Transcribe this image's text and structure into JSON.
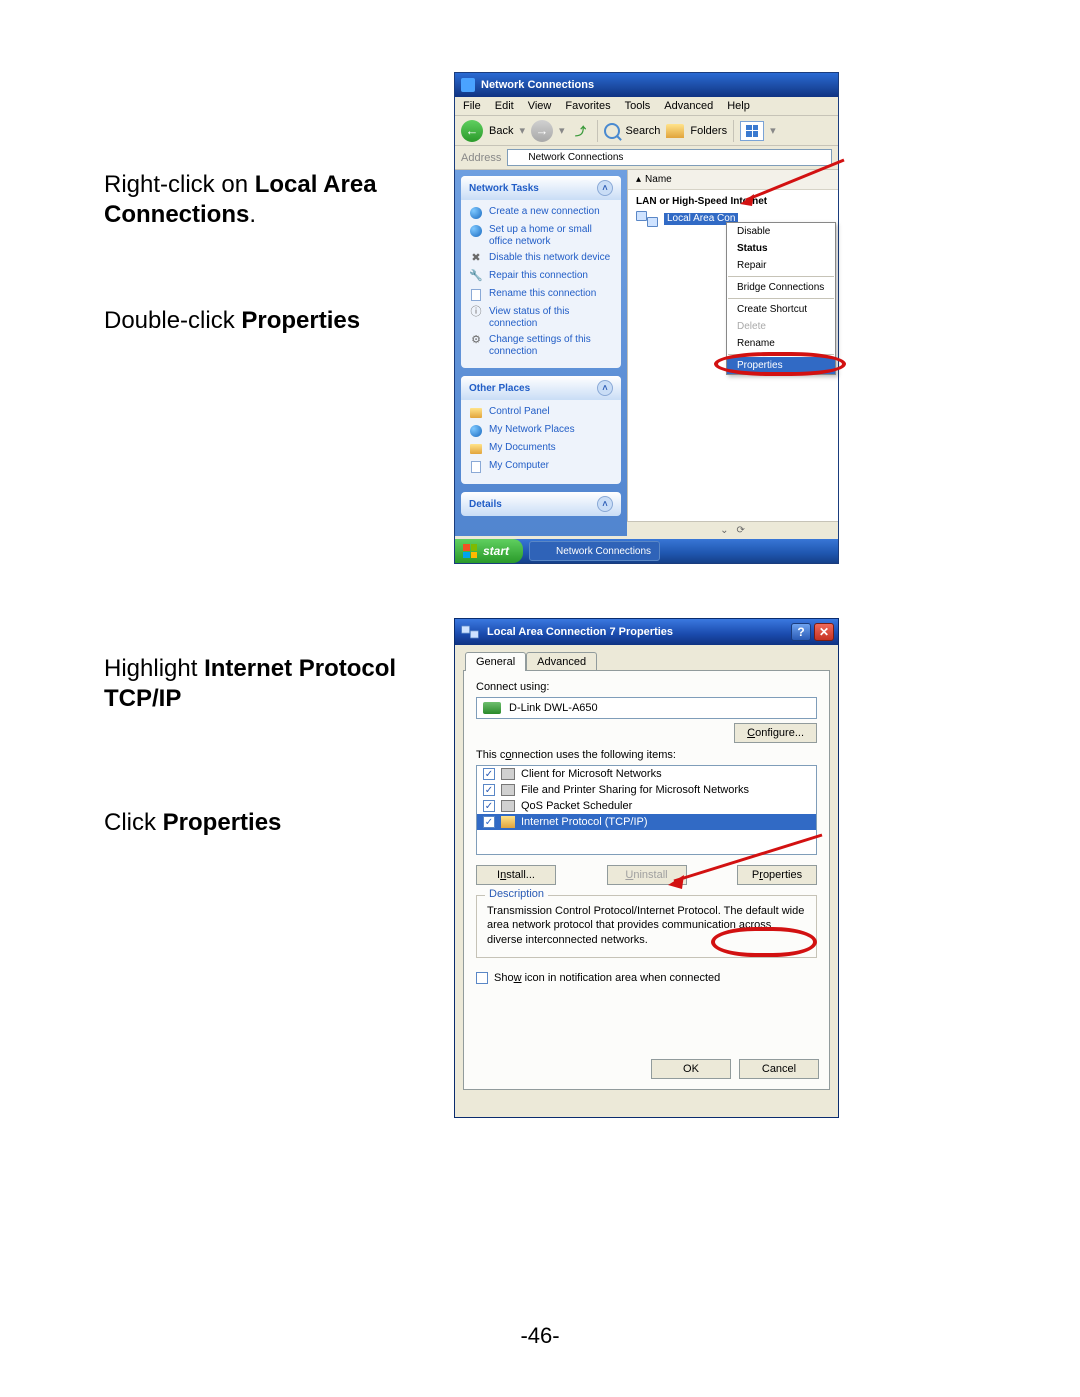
{
  "instructions": {
    "step1a": "Right-click on ",
    "step1b": "Local Area Connections",
    "step1c": ".",
    "step2a": "Double-click ",
    "step2b": "Properties",
    "step3a": "Highlight ",
    "step3b": "Internet Protocol TCP/IP",
    "step4a": "Click ",
    "step4b": "Properties"
  },
  "page_number": "-46-",
  "win1": {
    "title": "Network Connections",
    "menu": [
      "File",
      "Edit",
      "View",
      "Favorites",
      "Tools",
      "Advanced",
      "Help"
    ],
    "toolbar": {
      "back": "Back",
      "search": "Search",
      "folders": "Folders"
    },
    "address_label": "Address",
    "address_value": "Network Connections",
    "tasks_title": "Network Tasks",
    "tasks": [
      "Create a new connection",
      "Set up a home or small office network",
      "Disable this network device",
      "Repair this connection",
      "Rename this connection",
      "View status of this connection",
      "Change settings of this connection"
    ],
    "places_title": "Other Places",
    "places": [
      "Control Panel",
      "My Network Places",
      "My Documents",
      "My Computer"
    ],
    "details_title": "Details",
    "list_header": "Name",
    "category": "LAN or High-Speed Internet",
    "item": "Local Area Con",
    "context": {
      "disable": "Disable",
      "status": "Status",
      "repair": "Repair",
      "bridge": "Bridge Connections",
      "shortcut": "Create Shortcut",
      "delete": "Delete",
      "rename": "Rename",
      "properties": "Properties"
    },
    "start": "start",
    "taskbtn": "Network Connections"
  },
  "win2": {
    "title": "Local Area Connection 7 Properties",
    "tabs": {
      "general": "General",
      "advanced": "Advanced"
    },
    "connect_using": "Connect using:",
    "adapter": "D-Link DWL-A650",
    "configure": "Configure...",
    "uses_items": "This connection uses the following items:",
    "items": [
      "Client for Microsoft Networks",
      "File and Printer Sharing for Microsoft Networks",
      "QoS Packet Scheduler",
      "Internet Protocol (TCP/IP)"
    ],
    "install": "Install...",
    "uninstall": "Uninstall",
    "properties": "Properties",
    "desc_title": "Description",
    "desc_text": "Transmission Control Protocol/Internet Protocol. The default wide area network protocol that provides communication across diverse interconnected networks.",
    "show_icon": "Show icon in notification area when connected",
    "ok": "OK",
    "cancel": "Cancel"
  }
}
